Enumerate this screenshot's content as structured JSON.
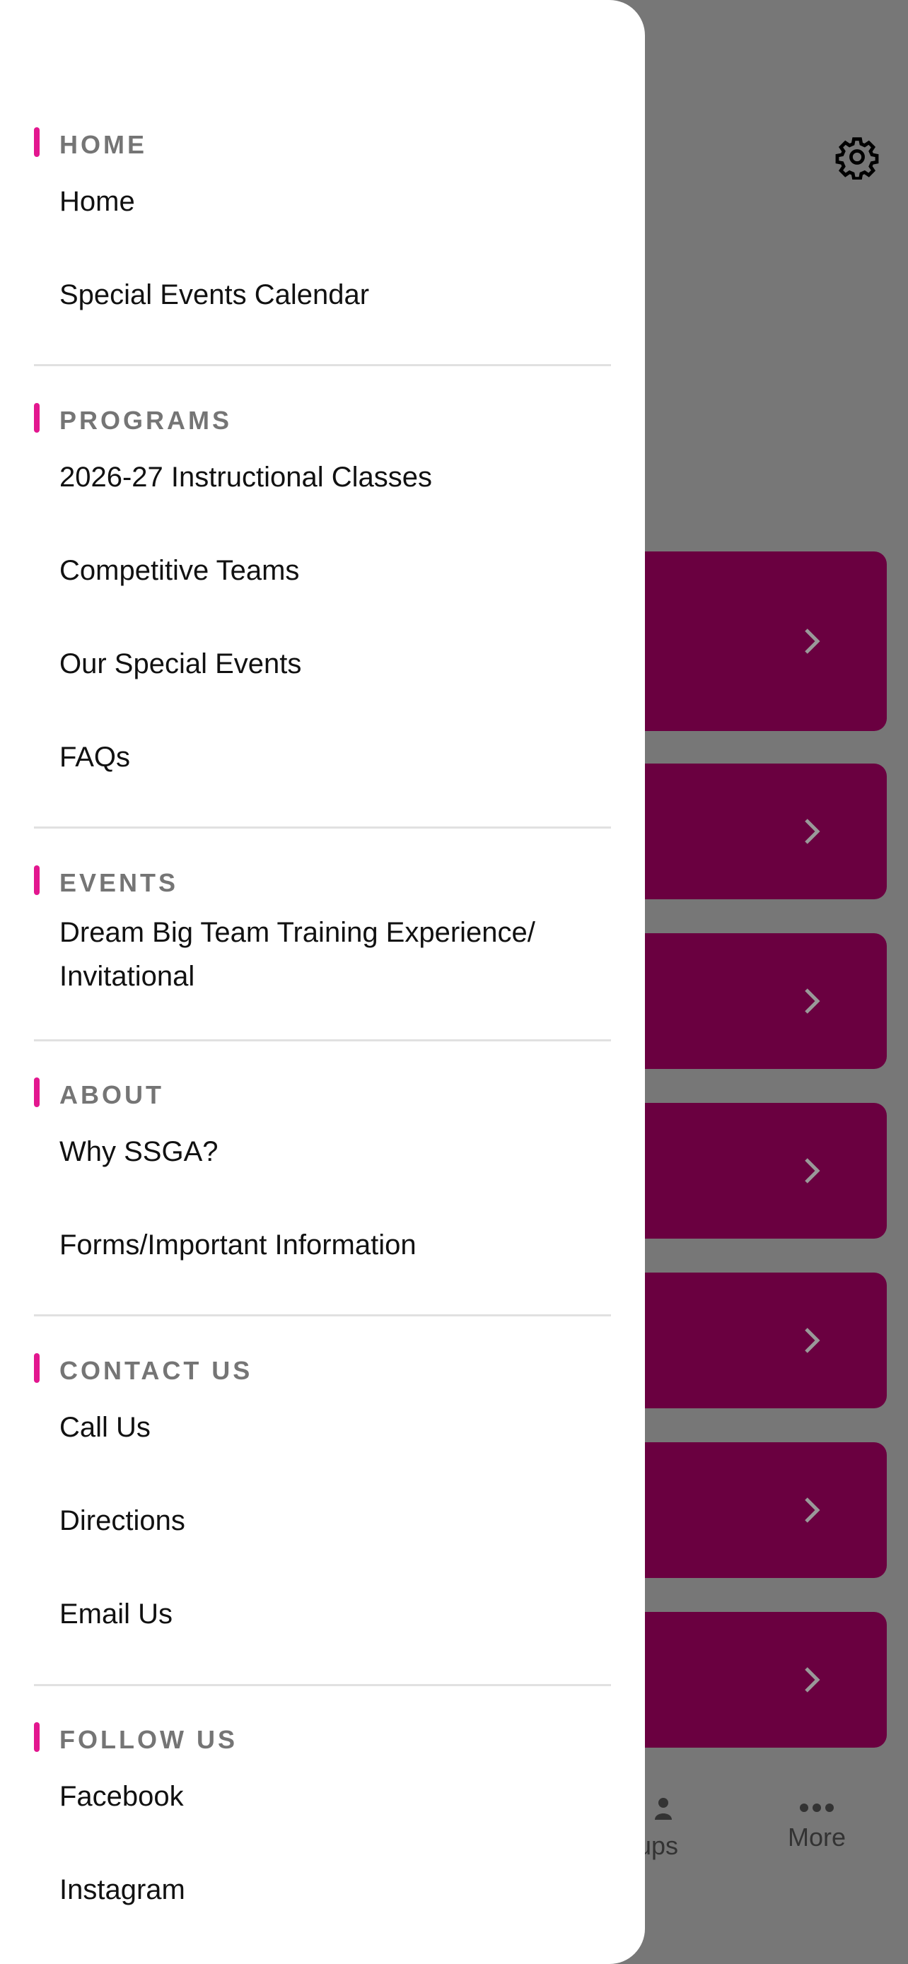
{
  "drawer": {
    "sections": [
      {
        "title": "HOME",
        "items": [
          "Home",
          "Special Events Calendar"
        ]
      },
      {
        "title": "PROGRAMS",
        "items": [
          "2026-27 Instructional Classes",
          "Competitive Teams",
          "Our Special Events",
          "FAQs"
        ]
      },
      {
        "title": "EVENTS",
        "items": [
          "Dream Big Team Training Experience/ Invitational"
        ]
      },
      {
        "title": "ABOUT",
        "items": [
          "Why SSGA?",
          "Forms/Important Information"
        ]
      },
      {
        "title": "CONTACT US",
        "items": [
          "Call Us",
          "Directions",
          "Email Us"
        ]
      },
      {
        "title": "FOLLOW US",
        "items": [
          "Facebook",
          "Instagram"
        ]
      }
    ]
  },
  "background": {
    "bottom_nav": {
      "groups_partial": "ups",
      "more": "More"
    },
    "icons": {
      "settings": "gear-icon",
      "chevron": "chevron-right-icon",
      "more": "more-dots-icon",
      "groups": "groups-icon"
    }
  },
  "colors": {
    "accent": "#e3178f",
    "card": "#6a0040",
    "overlay": "#777777"
  }
}
